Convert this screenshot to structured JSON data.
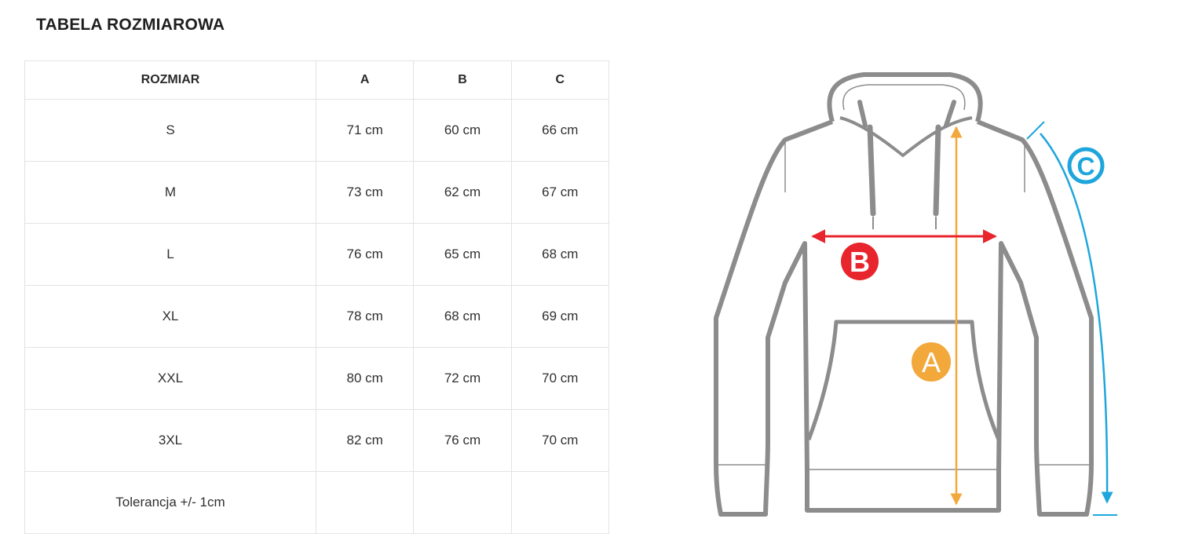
{
  "title": "TABELA ROZMIAROWA",
  "table": {
    "headers": [
      "ROZMIAR",
      "A",
      "B",
      "C"
    ],
    "rows": [
      [
        "S",
        "71 cm",
        "60 cm",
        "66 cm"
      ],
      [
        "M",
        "73 cm",
        "62 cm",
        "67 cm"
      ],
      [
        "L",
        "76 cm",
        "65 cm",
        "68 cm"
      ],
      [
        "XL",
        "78 cm",
        "68 cm",
        "69 cm"
      ],
      [
        "XXL",
        "80 cm",
        "72 cm",
        "70 cm"
      ],
      [
        "3XL",
        "82 cm",
        "76 cm",
        "70 cm"
      ],
      [
        "Tolerancja +/- 1cm",
        "",
        "",
        ""
      ]
    ]
  },
  "figure": {
    "labels": {
      "a": "A",
      "b": "B",
      "c": "C"
    },
    "colors": {
      "outline": "#8c8c8c",
      "a": "#f2a83b",
      "b": "#e8242c",
      "c": "#1ea6dc"
    }
  }
}
